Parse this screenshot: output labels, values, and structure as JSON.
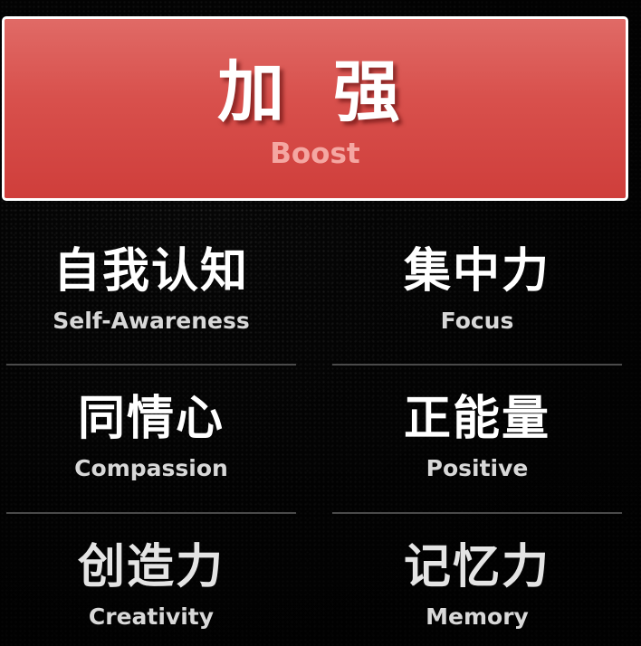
{
  "boost": {
    "title": "加 强",
    "subtitle": "Boost"
  },
  "items": [
    {
      "zh": "自我认知",
      "en": "Self-Awareness"
    },
    {
      "zh": "集中力",
      "en": "Focus"
    },
    {
      "zh": "同情心",
      "en": "Compassion"
    },
    {
      "zh": "正能量",
      "en": "Positive"
    },
    {
      "zh": "创造力",
      "en": "Creativity"
    },
    {
      "zh": "记忆力",
      "en": "Memory"
    }
  ],
  "colors": {
    "boost_red": "#d8504c",
    "background": "#070707",
    "divider": "#4a4a4a"
  }
}
